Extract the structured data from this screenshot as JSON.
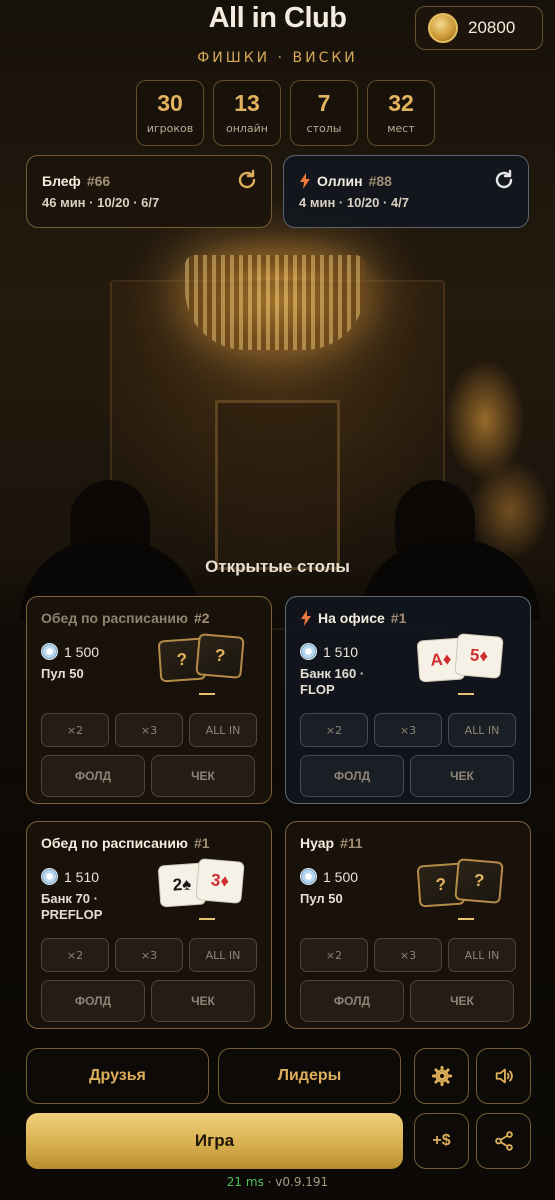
{
  "header": {
    "title": "All in Club",
    "subtitle": "ФИШКИ · ВИСКИ",
    "balance": "20800"
  },
  "stats": [
    {
      "value": "30",
      "label": "игроков"
    },
    {
      "value": "13",
      "label": "онлайн"
    },
    {
      "value": "7",
      "label": "столы"
    },
    {
      "value": "32",
      "label": "мест"
    }
  ],
  "recent": [
    {
      "name": "Блеф",
      "num": "#66",
      "meta": "46 мин · 10/20 · 6/7",
      "hot": false
    },
    {
      "name": "Оллин",
      "num": "#88",
      "meta": "4 мин · 10/20 · 4/7",
      "hot": true
    }
  ],
  "section_title": "Открытые столы",
  "tables": [
    {
      "name": "Обед по расписанию",
      "num": "#2",
      "chips": "1 500",
      "pot": "Пул 50",
      "cards": [
        "?",
        "?"
      ]
    },
    {
      "name": "На офисе",
      "num": "#1",
      "chips": "1 510",
      "pot": "Банк 160 · FLOP",
      "cards": [
        "A♦",
        "5♦"
      ]
    },
    {
      "name": "Обед по расписанию",
      "num": "#1",
      "chips": "1 510",
      "pot": "Банк 70 · PREFLOP",
      "cards": [
        "2♠",
        "3♦"
      ]
    },
    {
      "name": "Нуар",
      "num": "#11",
      "chips": "1 500",
      "pot": "Пул 50",
      "cards": [
        "?",
        "?"
      ]
    }
  ],
  "table_buttons": {
    "x2": "×2",
    "x3": "×3",
    "allin": "ALL IN",
    "fold": "ФОЛД",
    "check": "ЧЕК"
  },
  "nav": {
    "friends": "Друзья",
    "leaders": "Лидеры",
    "play": "Игра",
    "add_money": "+$"
  },
  "footer": {
    "ping": "21 ms",
    "separator": " · ",
    "version": "v0.9.191"
  },
  "colors": {
    "accent_gold": "#dcae5c",
    "play_button": "#d9b04f",
    "ping_green": "#4fc25b",
    "card_red": "#cf2e2e"
  },
  "icons": [
    "coin-icon",
    "refresh-icon",
    "bolt-icon",
    "chip-icon",
    "settings-gear-icon",
    "speaker-icon",
    "share-icon"
  ]
}
